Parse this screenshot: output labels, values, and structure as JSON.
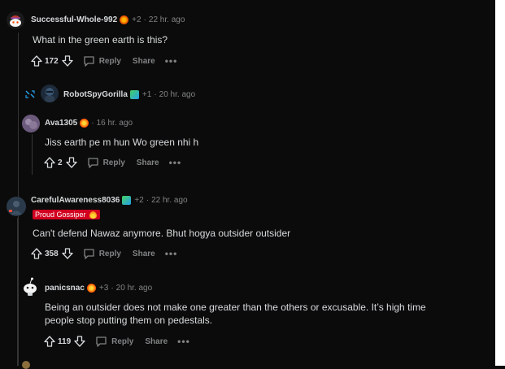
{
  "comments": [
    {
      "author": "Successful-Whole-992",
      "karma": "+2",
      "time": "22 hr. ago",
      "text": "What in the green earth is this?",
      "votes": "172",
      "reply": "Reply",
      "share": "Share"
    },
    {
      "author": "RobotSpyGorilla",
      "karma": "+1",
      "time": "20 hr. ago"
    },
    {
      "author": "Ava1305",
      "time": "16 hr. ago",
      "text": "Jiss earth pe m hun Wo green nhi h",
      "votes": "2",
      "reply": "Reply",
      "share": "Share"
    },
    {
      "author": "CarefulAwareness8036",
      "karma": "+2",
      "time": "22 hr. ago",
      "badge": "Proud Gossiper",
      "text": "Can't defend Nawaz anymore. Bhut hogya outsider outsider",
      "votes": "358",
      "reply": "Reply",
      "share": "Share"
    },
    {
      "author": "panicsnac",
      "karma": "+3",
      "time": "20 hr. ago",
      "text_line1": "Being an outsider does not make one greater than the others or excusable. It’s high time",
      "text_line2": "people stop putting them on pedestals.",
      "votes": "119",
      "reply": "Reply",
      "share": "Share"
    }
  ],
  "colors": {
    "background": "#0b0b0b",
    "meta": "#818384",
    "text": "#d7dadc",
    "badge": "#d1001f"
  }
}
